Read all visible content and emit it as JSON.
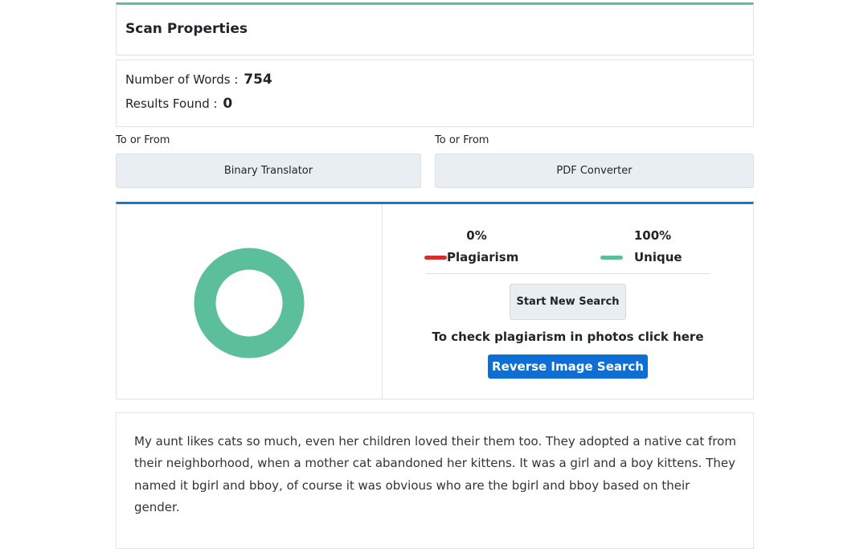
{
  "scan": {
    "title": "Scan Properties"
  },
  "stats": {
    "words_label": "Number of Words :",
    "words_value": "754",
    "results_label": "Results Found :",
    "results_value": "0"
  },
  "tools": [
    {
      "caption": "To or From",
      "label": "Binary Translator"
    },
    {
      "caption": "To or From",
      "label": "PDF Converter"
    }
  ],
  "result": {
    "plagiarism": {
      "percent": "0%",
      "label": "Plagiarism",
      "color": "#d32f2f",
      "value": 0
    },
    "unique": {
      "percent": "100%",
      "label": "Unique",
      "color": "#5cbf9b",
      "value": 100
    },
    "start_new_label": "Start New Search",
    "photo_text": "To check plagiarism in photos click here",
    "reverse_label": "Reverse Image Search"
  },
  "text": {
    "body": "My aunt likes cats so much, even her children loved their them too. They adopted a native cat from their neighborhood, when a mother cat abandoned her kittens. It was a girl and a boy kittens. They named it bgirl and bboy, of course it was obvious who are the bgirl and bboy based on their gender."
  }
}
